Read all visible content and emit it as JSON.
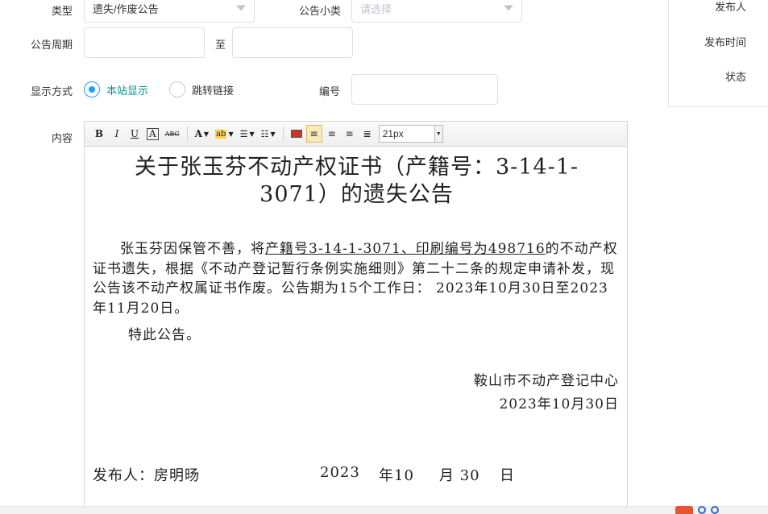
{
  "form": {
    "type_label": "类型",
    "type_value": "遗失/作废公告",
    "subtype_label": "公告小类",
    "subtype_placeholder": "请选择",
    "period_label": "公告周期",
    "period_to": "至",
    "display_label": "显示方式",
    "display_options": [
      "本站显示",
      "跳转链接"
    ],
    "display_selected": "本站显示",
    "number_label": "编号",
    "content_label": "内容"
  },
  "side": {
    "publisher_label": "发布人",
    "time_label": "发布时间",
    "status_label": "状态"
  },
  "toolbar": {
    "bold": "B",
    "italic": "I",
    "underline": "U",
    "fontcolor": "A",
    "strike": "ABC",
    "fontsize_value": "21px"
  },
  "document": {
    "title_line1": "关于张玉芬不动产权证书（产籍号：3-14-1-",
    "title_line2": "3071）的遗失公告",
    "body_pre": "张玉芬因保管不善，将",
    "body_underlined": "产籍号3-14-1-3071、印刷编号为498716",
    "body_post": "的不动产权证书遗失，根据《不动产登记暂行条例实施细则》第二十二条的规定申请补发，现公告该不动产权属证书作废。公告期为15个工作日：  2023年10月30日至2023年11月20日。",
    "closing": "特此公告。",
    "issuer": "鞍山市不动产登记中心",
    "issue_date": "2023年10月30日",
    "sig_label": "发布人：房明",
    "sig_name_char": "旸",
    "sig_year": "2023",
    "sig_year_unit": "年10",
    "sig_month_unit": "月 30",
    "sig_day_unit": "日"
  }
}
